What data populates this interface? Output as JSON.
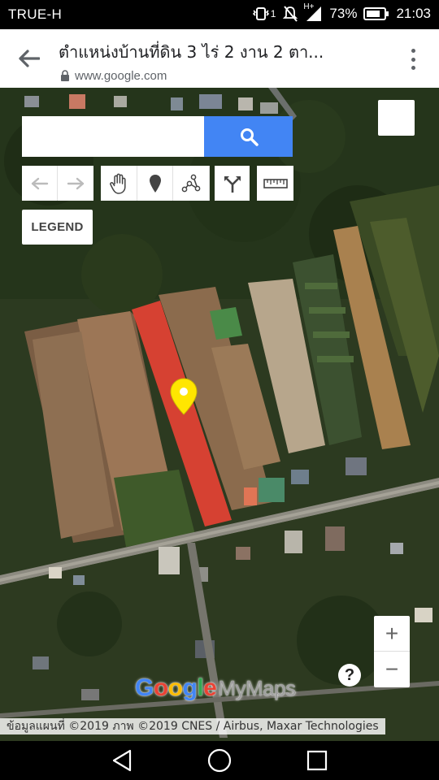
{
  "status_bar": {
    "carrier": "TRUE-H",
    "sim_indicator": "1",
    "network_type": "H+",
    "battery_percent": "73%",
    "time": "21:03",
    "icons": [
      "vibrate-icon",
      "mute-icon",
      "signal-icon",
      "battery-icon"
    ]
  },
  "browser": {
    "page_title": "ตำแหน่งบ้านที่ดิน 3 ไร่ 2 งาน 2 ตา...",
    "url": "www.google.com",
    "icons": [
      "back-arrow-icon",
      "lock-icon",
      "more-vert-icon"
    ]
  },
  "map": {
    "search": {
      "value": "",
      "placeholder": ""
    },
    "legend_label": "LEGEND",
    "zoom_in_label": "+",
    "zoom_out_label": "−",
    "help_label": "?",
    "brand": {
      "g": "G",
      "o1": "o",
      "o2": "o",
      "g2": "g",
      "l": "l",
      "e": "e",
      "product": "MyMaps"
    },
    "attribution": "ข้อมูลแผนที่ ©2019 ภาพ ©2019 CNES / Airbus, Maxar Technologies",
    "highlight_color": "#f44336",
    "marker_color": "#ffe600",
    "toolbar_icons": [
      "undo-icon",
      "redo-icon",
      "hand-pan-icon",
      "add-marker-icon",
      "draw-line-icon",
      "directions-icon",
      "measure-ruler-icon"
    ]
  },
  "nav_bar": {
    "icons": [
      "nav-back-icon",
      "nav-home-icon",
      "nav-recents-icon"
    ]
  }
}
